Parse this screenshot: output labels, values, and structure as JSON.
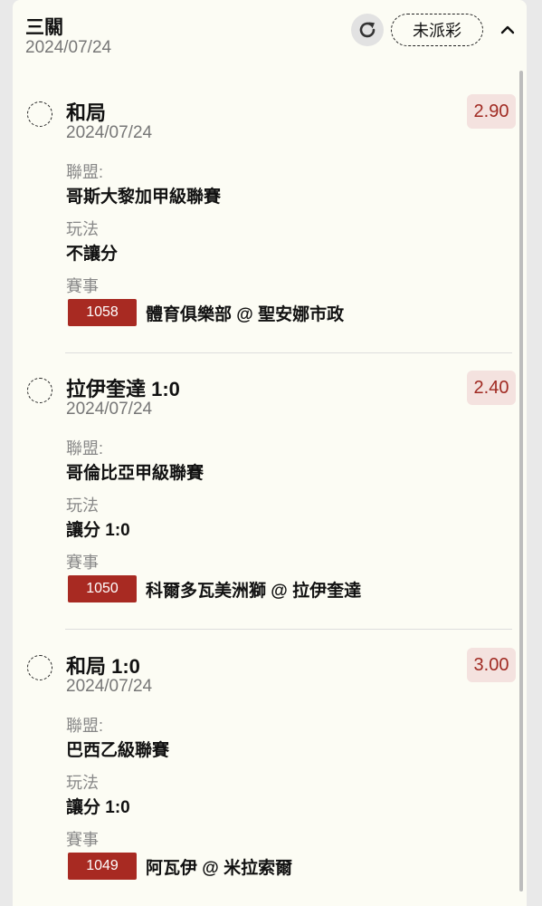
{
  "header": {
    "title": "三關",
    "date": "2024/07/24",
    "status": "未派彩",
    "refresh_icon": "refresh-icon",
    "collapse_icon": "chevron-up-icon"
  },
  "labels": {
    "league": "聯盟:",
    "play": "玩法",
    "match": "賽事"
  },
  "colors": {
    "accent": "#a82a22",
    "odds_bg": "#f4e2df",
    "card_bg": "#fcfcf4"
  },
  "bets": [
    {
      "selection": "和局",
      "date": "2024/07/24",
      "odds": "2.90",
      "league": "哥斯大黎加甲級聯賽",
      "play": "不讓分",
      "match_id": "1058",
      "match_name": "體育俱樂部 @ 聖安娜市政"
    },
    {
      "selection": "拉伊奎達 1:0",
      "date": "2024/07/24",
      "odds": "2.40",
      "league": "哥倫比亞甲級聯賽",
      "play": "讓分 1:0",
      "match_id": "1050",
      "match_name": "科爾多瓦美洲獅 @ 拉伊奎達"
    },
    {
      "selection": "和局 1:0",
      "date": "2024/07/24",
      "odds": "3.00",
      "league": "巴西乙級聯賽",
      "play": "讓分 1:0",
      "match_id": "1049",
      "match_name": "阿瓦伊 @ 米拉索爾"
    }
  ]
}
